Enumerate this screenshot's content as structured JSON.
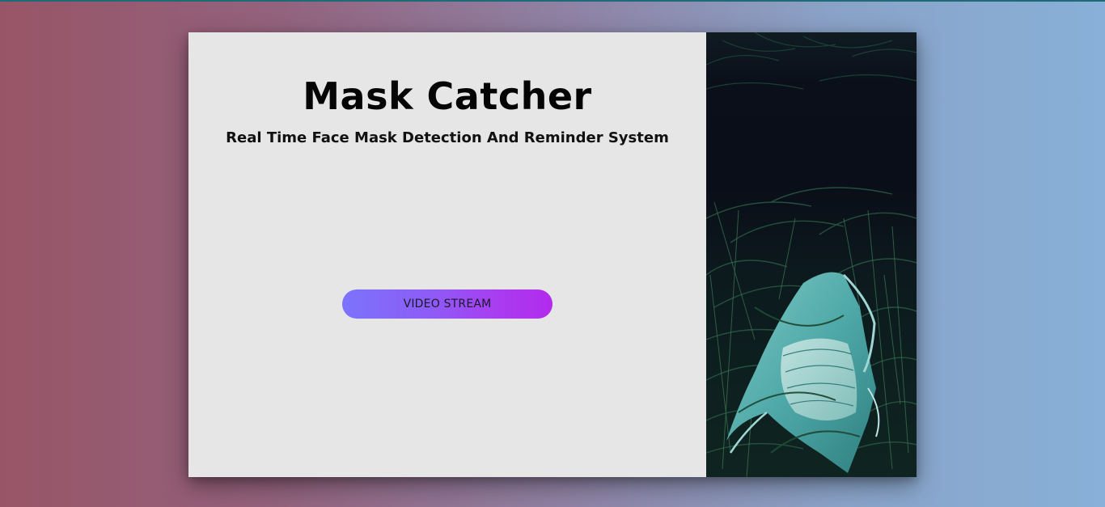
{
  "hero": {
    "title": "Mask Catcher",
    "subtitle": "Real Time Face Mask Detection And Reminder System",
    "button_label": "VIDEO STREAM"
  },
  "photo": {
    "subject": "surgical face mask lying in dark green grass"
  },
  "colors": {
    "background_left": "#985567",
    "background_right": "#88b0d8",
    "card_background": "#e7e6e7",
    "button_gradient_start": "#7b73fc",
    "button_gradient_end": "#b22bec"
  }
}
